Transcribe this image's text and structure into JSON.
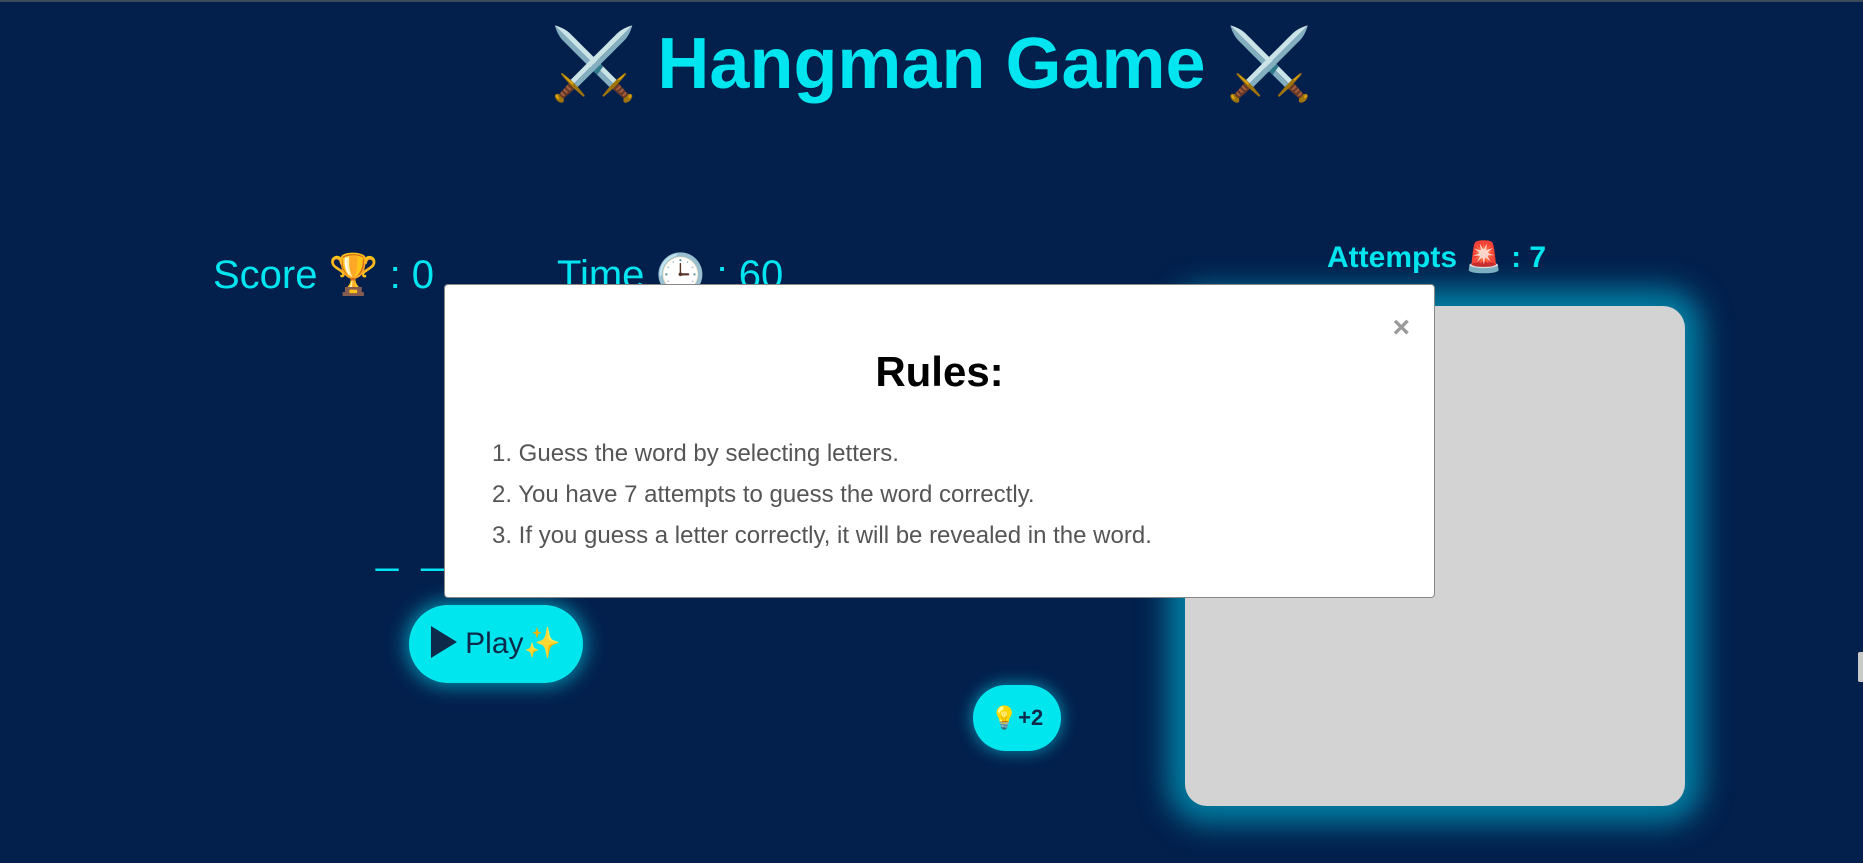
{
  "header": {
    "title": "Hangman Game",
    "title_left_icon": "⚔️",
    "title_right_icon": "⚔️"
  },
  "stats": {
    "score_label": "Score",
    "score_icon": "🏆",
    "score_value": ": 0",
    "time_label": "Time",
    "time_icon": "🕒",
    "time_value": ": 60",
    "attempts_label": "Attempts",
    "attempts_icon": "🚨",
    "attempts_value": ": 7"
  },
  "word": {
    "dashes": "_ _"
  },
  "buttons": {
    "play_label": "Play",
    "play_icon": "✨",
    "hint_icon": "💡",
    "hint_label": "+2"
  },
  "modal": {
    "close_label": "×",
    "heading": "Rules:",
    "rules": [
      "1. Guess the word by selecting letters.",
      "2. You have 7 attempts to guess the word correctly.",
      "3. If you guess a letter correctly, it will be revealed in the word."
    ]
  },
  "colors": {
    "background": "#03204d",
    "accent": "#00e5ef",
    "board": "#d3d3d3",
    "modal": "#ffffff"
  }
}
